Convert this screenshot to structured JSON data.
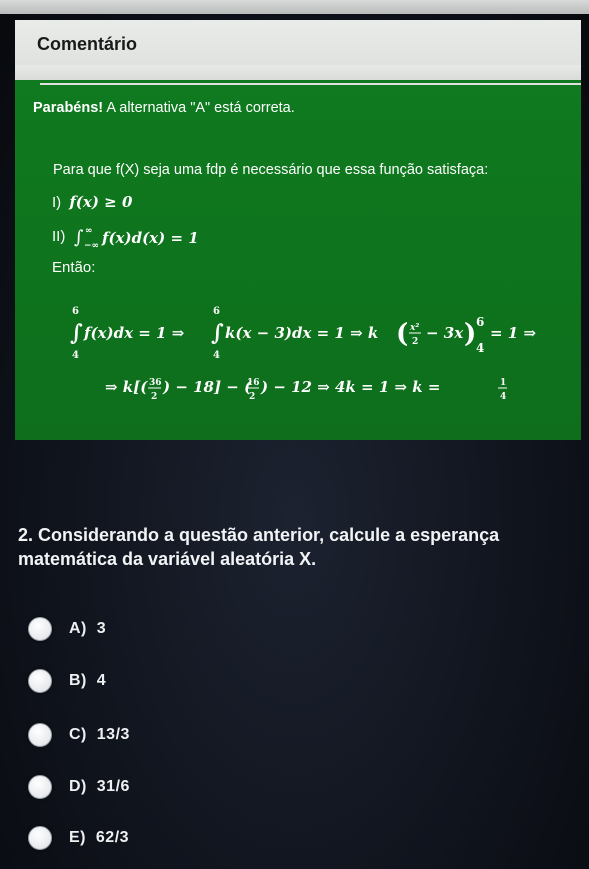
{
  "comment": {
    "title": "Comentário"
  },
  "feedback": {
    "congrats": "Parabéns!",
    "result": "A alternativa \"A\" está correta.",
    "intro": "Para que f(X) seja uma fdp é necessário que essa função satisfaça:",
    "cond1_label": "I)",
    "cond1_math": "f(x) ≥ 0",
    "cond2_label": "II)",
    "cond2_math": "∫_{−∞}^{∞} f(x)d(x) = 1",
    "then_label": "Então:"
  },
  "derivation": {
    "line1": "∫_4^6 f(x)dx = 1 ⇒ ∫_4^6 k(x − 3)dx = 1 ⇒ k(x²/2 − 3x)|_4^6 = 1 ⇒",
    "line2": "⇒ k[(36/2) − 18] − (16/2) − 12 ⇒ 4k = 1 ⇒ k = 1/4"
  },
  "question": {
    "text": "2. Considerando a questão anterior, calcule a esperança matemática da variável aleatória X."
  },
  "options": [
    {
      "label": "A)",
      "value": "3"
    },
    {
      "label": "B)",
      "value": "4"
    },
    {
      "label": "C)",
      "value": "13/3"
    },
    {
      "label": "D)",
      "value": "31/6"
    },
    {
      "label": "E)",
      "value": "62/3"
    }
  ]
}
